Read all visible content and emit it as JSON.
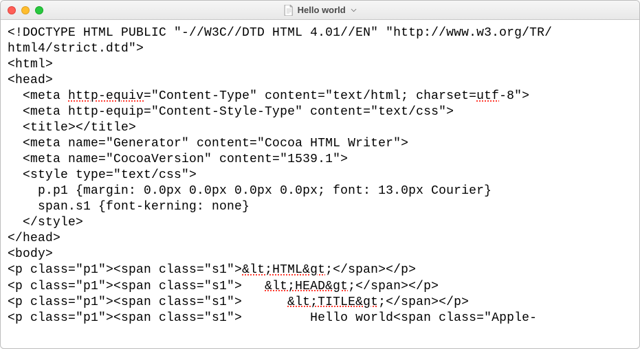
{
  "window": {
    "title": "Hello world",
    "docIcon": "document-icon"
  },
  "editor": {
    "lines": [
      {
        "segments": [
          {
            "t": "<!DOCTYPE HTML PUBLIC \"-//W3C//DTD HTML 4.01//EN\" \"http://www.w3.org/TR/"
          }
        ]
      },
      {
        "segments": [
          {
            "t": "html4/strict.dtd\">"
          }
        ]
      },
      {
        "segments": [
          {
            "t": "<html>"
          }
        ]
      },
      {
        "segments": [
          {
            "t": "<head>"
          }
        ]
      },
      {
        "segments": [
          {
            "t": "  <meta "
          },
          {
            "t": "http-equiv",
            "err": true
          },
          {
            "t": "=\"Content-Type\" content=\"text/html; charset="
          },
          {
            "t": "utf",
            "err": true
          },
          {
            "t": "-8\">"
          }
        ]
      },
      {
        "segments": [
          {
            "t": "  <meta http-equip=\"Content-Style-Type\" content=\"text/css\">"
          }
        ]
      },
      {
        "segments": [
          {
            "t": "  <title></title>"
          }
        ]
      },
      {
        "segments": [
          {
            "t": "  <meta name=\"Generator\" content=\"Cocoa HTML Writer\">"
          }
        ]
      },
      {
        "segments": [
          {
            "t": "  <meta name=\"CocoaVersion\" content=\"1539.1\">"
          }
        ]
      },
      {
        "segments": [
          {
            "t": "  <style type=\"text/css\">"
          }
        ]
      },
      {
        "segments": [
          {
            "t": "    p.p1 {margin: 0.0px 0.0px 0.0px 0.0px; font: 13.0px Courier}"
          }
        ]
      },
      {
        "segments": [
          {
            "t": "    span.s1 {font-kerning: none}"
          }
        ]
      },
      {
        "segments": [
          {
            "t": "  </style>"
          }
        ]
      },
      {
        "segments": [
          {
            "t": "</head>"
          }
        ]
      },
      {
        "segments": [
          {
            "t": "<body>"
          }
        ]
      },
      {
        "segments": [
          {
            "t": "<p class=\"p1\"><span class=\"s1\">"
          },
          {
            "t": "&lt;HTML&gt",
            "err": true
          },
          {
            "t": ";</span></p>"
          }
        ]
      },
      {
        "segments": [
          {
            "t": "<p class=\"p1\"><span class=\"s1\">   "
          },
          {
            "t": "&lt;HEAD&gt",
            "err": true
          },
          {
            "t": ";</span></p>"
          }
        ]
      },
      {
        "segments": [
          {
            "t": "<p class=\"p1\"><span class=\"s1\">      "
          },
          {
            "t": "&lt;TITLE&gt",
            "err": true
          },
          {
            "t": ";</span></p>"
          }
        ]
      },
      {
        "segments": [
          {
            "t": "<p class=\"p1\"><span class=\"s1\">         Hello world<span class=\"Apple-"
          }
        ]
      }
    ]
  }
}
